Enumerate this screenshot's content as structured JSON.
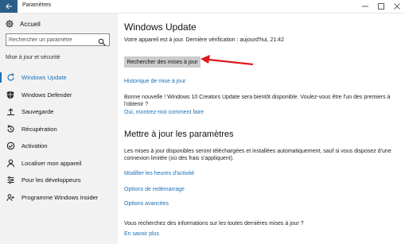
{
  "window": {
    "title": "Paramètres"
  },
  "sidebar": {
    "home_label": "Accueil",
    "search_placeholder": "Rechercher un paramètre",
    "section_label": "Mise à jour et sécurité",
    "items": [
      {
        "label": "Windows Update",
        "icon": "refresh-icon",
        "active": true
      },
      {
        "label": "Windows Defender",
        "icon": "shield-icon"
      },
      {
        "label": "Sauvegarde",
        "icon": "backup-icon"
      },
      {
        "label": "Récupération",
        "icon": "recovery-icon"
      },
      {
        "label": "Activation",
        "icon": "activation-icon"
      },
      {
        "label": "Localiser mon appareil",
        "icon": "person-icon"
      },
      {
        "label": "Pour les développeurs",
        "icon": "developer-icon"
      },
      {
        "label": "Programme Windows Insider",
        "icon": "insider-icon"
      }
    ]
  },
  "main": {
    "title": "Windows Update",
    "status": "Votre appareil est à jour. Dernière vérification : aujourd'hui, 21:42",
    "check_button": "Rechercher des mises à jour",
    "history_link": "Historique de mise à jour",
    "news": "Bonne nouvelle ! Windows 10 Creators Update sera bientôt disponible. Voulez-vous être l'un des premiers à l'obtenir ?",
    "news_link": "Oui, montrez-moi comment faire",
    "settings_title": "Mettre à jour les paramètres",
    "settings_info": "Les mises à jour disponibles seront téléchargées et installées automatiquement, sauf si vous disposez d'une connexion limitée (où des frais s'appliquent).",
    "options": [
      "Modifier les heures d'activité",
      "Options de redémarrage",
      "Options avancées"
    ],
    "question": "Vous recherchez des informations sur les toutes dernières mises à jour ?",
    "learn_more": "En savoir plus"
  },
  "colors": {
    "accent": "#1b6fb4",
    "back_button": "#2b5f8a",
    "sidebar_bg": "#f2f2f2",
    "button_bg": "#cccccc",
    "annotation_arrow": "#e0191f"
  }
}
